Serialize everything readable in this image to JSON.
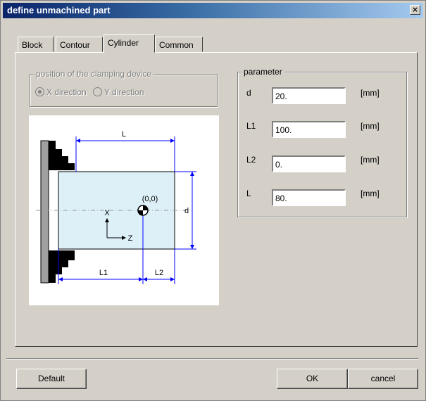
{
  "window": {
    "title": "define unmachined part",
    "close_glyph": "×"
  },
  "tabs": [
    {
      "label": "Block"
    },
    {
      "label": "Contour"
    },
    {
      "label": "Cylinder"
    },
    {
      "label": "Common"
    }
  ],
  "active_tab": "Cylinder",
  "clamping": {
    "legend": "position of the clamping device",
    "options": [
      {
        "label": "X direction",
        "selected": true
      },
      {
        "label": "Y direction",
        "selected": false
      }
    ],
    "enabled": false
  },
  "parameter": {
    "legend": "parameter",
    "fields": [
      {
        "label": "d",
        "value": "20.",
        "unit": "[mm]"
      },
      {
        "label": "L1",
        "value": "100.",
        "unit": "[mm]"
      },
      {
        "label": "L2",
        "value": "0.",
        "unit": "[mm]"
      },
      {
        "label": "L",
        "value": "80.",
        "unit": "[mm]"
      }
    ]
  },
  "diagram": {
    "label_L": "L",
    "label_d": "d",
    "label_L1": "L1",
    "label_L2": "L2",
    "origin": "(0,0)",
    "axis_x": "X",
    "axis_z": "Z",
    "colors": {
      "cylinder_fill": "#ddf0f8",
      "dim_line": "#0000ff",
      "chuck": "#000000"
    }
  },
  "buttons": {
    "default": "Default",
    "ok": "OK",
    "cancel": "cancel"
  }
}
